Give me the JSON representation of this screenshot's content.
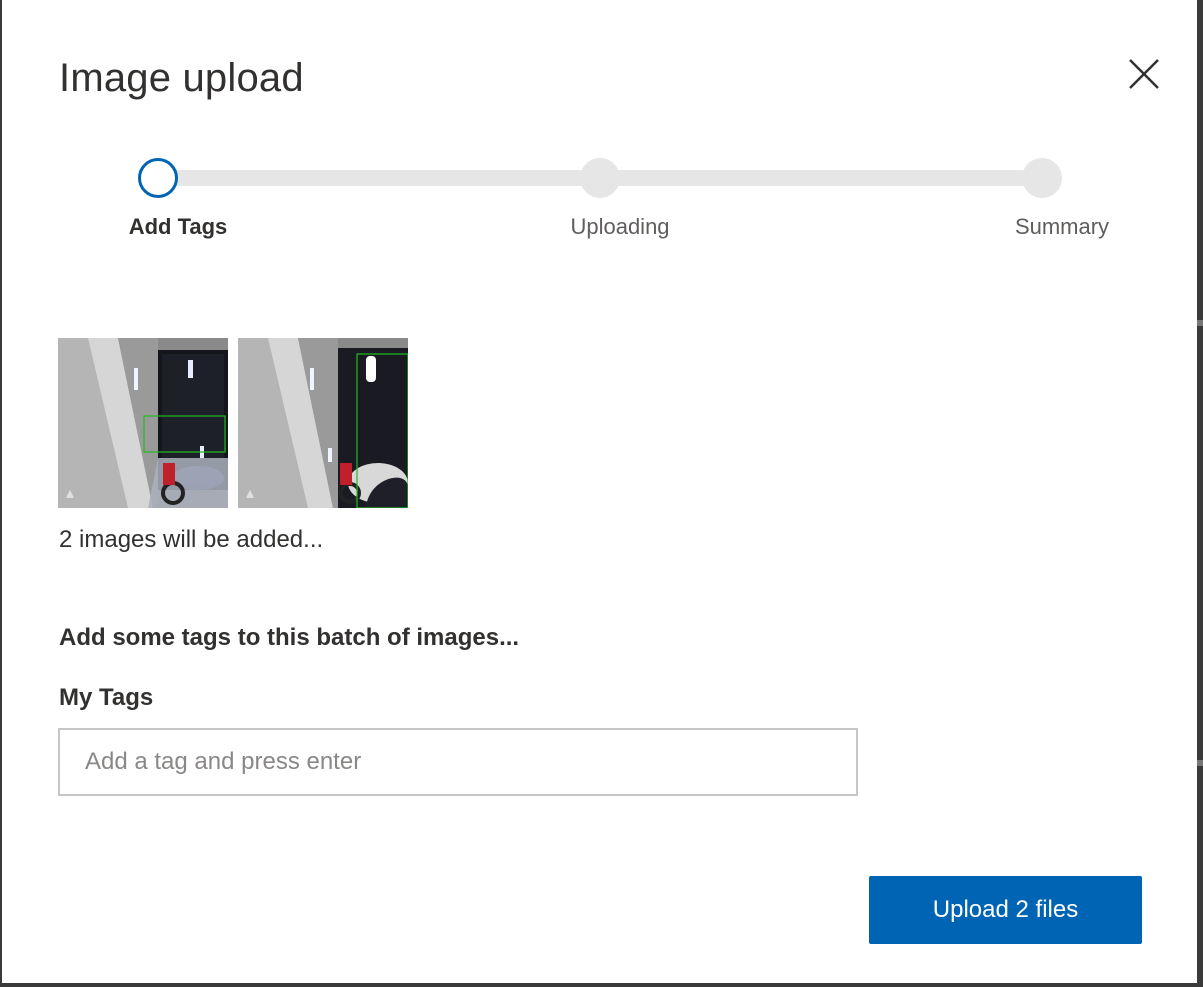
{
  "dialog": {
    "title": "Image upload",
    "close_icon": "close-icon"
  },
  "stepper": {
    "steps": [
      {
        "label": "Add Tags",
        "state": "active"
      },
      {
        "label": "Uploading",
        "state": "pending"
      },
      {
        "label": "Summary",
        "state": "pending"
      }
    ]
  },
  "images": {
    "count_text": "2 images will be added...",
    "thumbnails": [
      "thumbnail-1",
      "thumbnail-2"
    ]
  },
  "tags": {
    "prompt": "Add some tags to this batch of images...",
    "label": "My Tags",
    "input_placeholder": "Add a tag and press enter",
    "input_value": ""
  },
  "actions": {
    "upload_label": "Upload 2 files"
  },
  "colors": {
    "accent": "#0064b4",
    "track": "#e6e6e6",
    "text": "#323130",
    "detection_box": "#1fbf1f"
  }
}
